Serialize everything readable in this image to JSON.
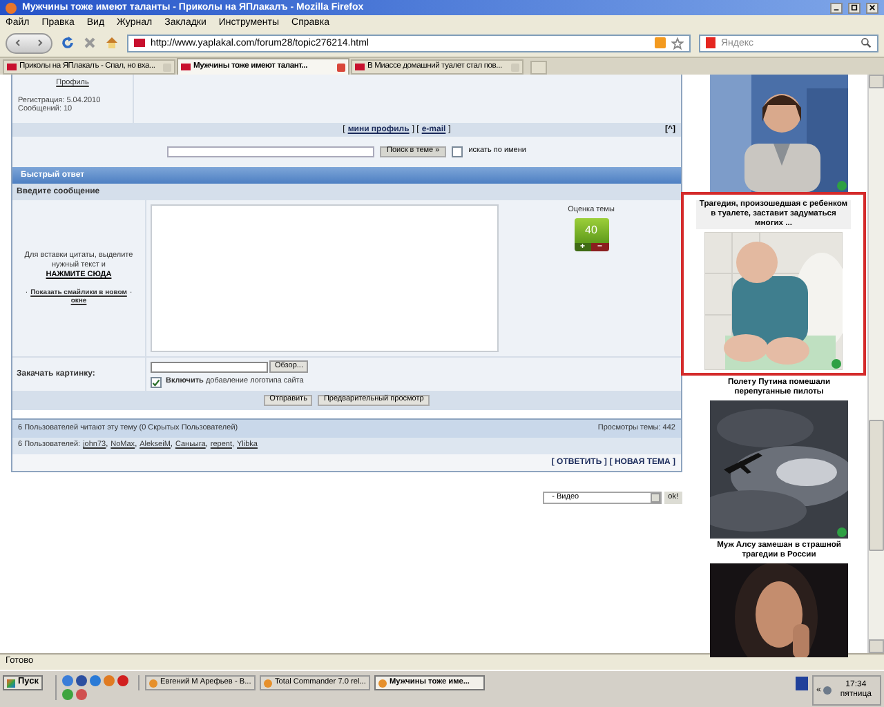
{
  "window": {
    "title": "Мужчины тоже имеют таланты - Приколы на ЯПлакалъ - Mozilla Firefox"
  },
  "menu": [
    "Файл",
    "Правка",
    "Вид",
    "Журнал",
    "Закладки",
    "Инструменты",
    "Справка"
  ],
  "toolbar": {
    "url": "http://www.yaplakal.com/forum28/topic276214.html",
    "search_placeholder": "Яндекс"
  },
  "tabs": [
    {
      "label": "Приколы на ЯПлакалъ - Спал, но вха...",
      "selected": false
    },
    {
      "label": "Мужчины тоже имеют талант...",
      "selected": true
    },
    {
      "label": "В Миассе домашний туалет стал пов...",
      "selected": false
    }
  ],
  "profile": {
    "link": "Профиль",
    "registered": "Регистрация: 5.04.2010",
    "posts": "Сообщений: 10",
    "links": [
      {
        "kind": "plain",
        "text": "["
      },
      {
        "kind": "link",
        "text": "мини профиль"
      },
      {
        "kind": "plain",
        "text": "] ["
      },
      {
        "kind": "link",
        "text": "e-mail"
      },
      {
        "kind": "plain",
        "text": "]"
      }
    ],
    "top_link": "[^]"
  },
  "search": {
    "button": "Поиск в теме »",
    "checkbox_label": "искать по имени",
    "checked": false
  },
  "quick_reply": {
    "title": "Быстрый ответ",
    "subtitle": "Введите сообщение",
    "hint": "Для вставки цитаты, выделите нужный текст и",
    "hint_link": "НАЖМИТЕ СЮДА",
    "smilies_prefix": "·",
    "smilies_link": "Показать смайлики в новом окне",
    "smilies_suffix": "·",
    "rating": {
      "label": "Оценка темы",
      "value": "40",
      "plus": "+",
      "minus": "−"
    },
    "upload_label": "Закачать картинку:",
    "browse": "Обзор...",
    "logo_checked": true,
    "logo_label": "**Включить** добавление логотипа сайта",
    "buttons": [
      "Отправить",
      "Предварительный просмотр"
    ]
  },
  "readers": {
    "summary": "6 Пользователей читают эту тему (0 Скрытых Пользователей)",
    "views": "Просмотры темы: 442",
    "prefix": "6 Пользователей:",
    "separator": ",",
    "users": [
      "john73",
      "NoMax",
      "AlekseiM",
      "Саньыга",
      "repent",
      "Ylibka"
    ]
  },
  "actions": [
    "[ ОТВЕТИТЬ ]",
    "[ НОВАЯ ТЕМА ]"
  ],
  "jump": {
    "value": "- Видео",
    "button": "ok!"
  },
  "ads": [
    {
      "kind": "picture",
      "dot": true,
      "highlighted": false
    },
    {
      "kind": "picture",
      "caption": "Трагедия, произошедшая с ребенком в туалете, заставит задуматься многих ...",
      "dot": true,
      "highlighted": true
    },
    {
      "kind": "picture",
      "caption": "Полету Путина помешали перепуганные пилоты",
      "dot": true,
      "highlighted": false
    },
    {
      "kind": "picture",
      "caption": "Муж Алсу замешан в страшной трагедии в России",
      "dot": false,
      "highlighted": false
    }
  ],
  "status": "Готово",
  "taskbar": {
    "start": "Пуск",
    "tasks": [
      {
        "label": "Евгений М Арефьев - В...",
        "selected": false
      },
      {
        "label": "Total Commander 7.0 rel...",
        "selected": false
      },
      {
        "label": "Мужчины тоже име...",
        "selected": true
      }
    ],
    "tray_arrow": "«",
    "time": "17:34",
    "day": "пятница"
  }
}
